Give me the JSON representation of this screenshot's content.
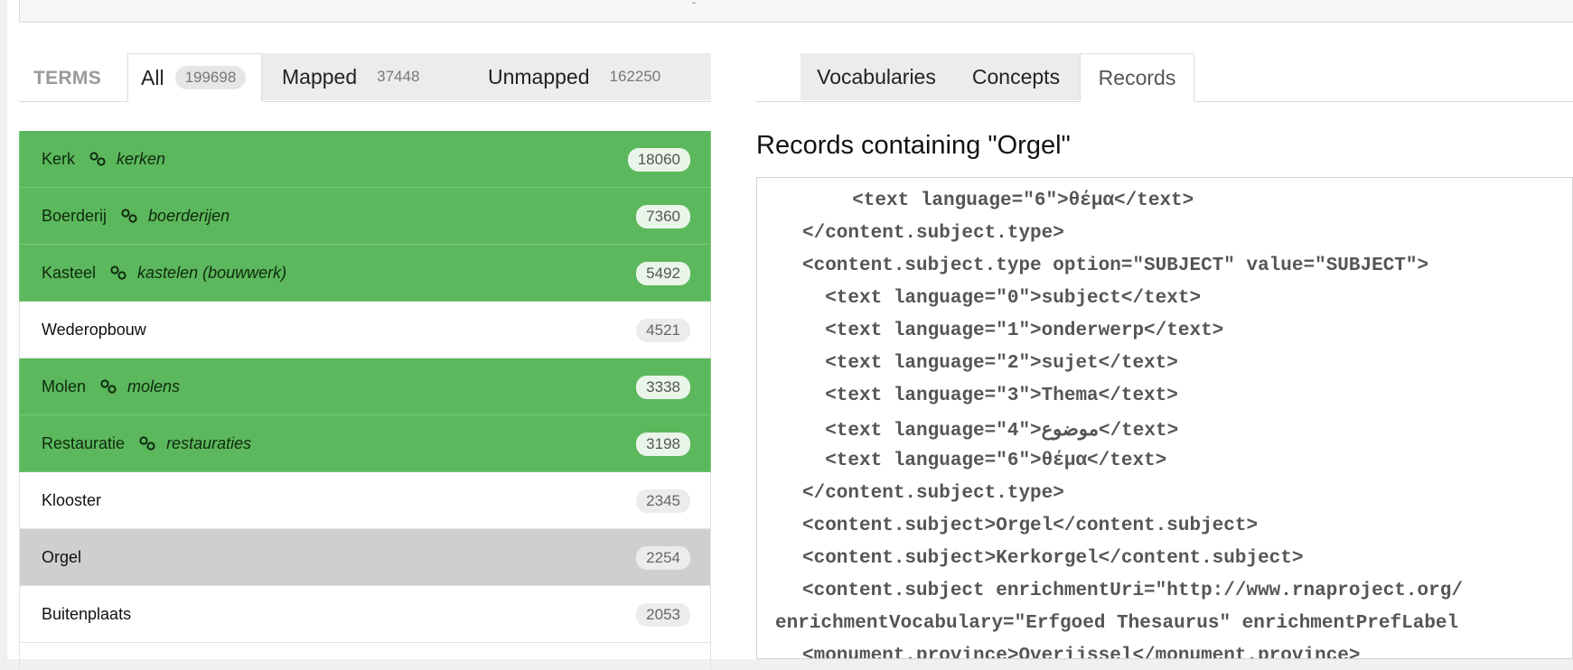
{
  "terms_tabs": {
    "label": "TERMS",
    "all": {
      "label": "All",
      "count": "199698"
    },
    "mapped": {
      "label": "Mapped",
      "count": "37448"
    },
    "unmapped": {
      "label": "Unmapped",
      "count": "162250"
    }
  },
  "terms": [
    {
      "term": "Kerk",
      "concept": "kerken",
      "count": "18060",
      "state": "mapped"
    },
    {
      "term": "Boerderij",
      "concept": "boerderijen",
      "count": "7360",
      "state": "mapped"
    },
    {
      "term": "Kasteel",
      "concept": "kastelen (bouwwerk)",
      "count": "5492",
      "state": "mapped"
    },
    {
      "term": "Wederopbouw",
      "concept": "",
      "count": "4521",
      "state": "unmapped"
    },
    {
      "term": "Molen",
      "concept": "molens",
      "count": "3338",
      "state": "mapped"
    },
    {
      "term": "Restauratie",
      "concept": "restauraties",
      "count": "3198",
      "state": "mapped"
    },
    {
      "term": "Klooster",
      "concept": "",
      "count": "2345",
      "state": "unmapped"
    },
    {
      "term": "Orgel",
      "concept": "",
      "count": "2254",
      "state": "selected"
    },
    {
      "term": "Buitenplaats",
      "concept": "",
      "count": "2053",
      "state": "unmapped"
    }
  ],
  "right_tabs": [
    "Vocabularies",
    "Concepts",
    "Records"
  ],
  "records_title": "Records containing \"Orgel\"",
  "code_lines": [
    "  <text language=\"6\">θέμα</text>",
    "</content.subject.type>",
    "<content.subject.type option=\"SUBJECT\" value=\"SUBJECT\">",
    "  <text language=\"0\">subject</text>",
    "  <text language=\"1\">onderwerp</text>",
    "  <text language=\"2\">sujet</text>",
    "  <text language=\"3\">Thema</text>",
    "  <text language=\"4\">موضوع</text>",
    "  <text language=\"6\">θέμα</text>",
    "</content.subject.type>",
    "<content.subject>Orgel</content.subject>",
    "<content.subject>Kerkorgel</content.subject>",
    "<content.subject enrichmentUri=\"http://www.rnaproject.org/",
    "enrichmentVocabulary=\"Erfgoed Thesaurus\" enrichmentPrefLabel",
    "<monument.province>Overijssel</monument.province>"
  ]
}
